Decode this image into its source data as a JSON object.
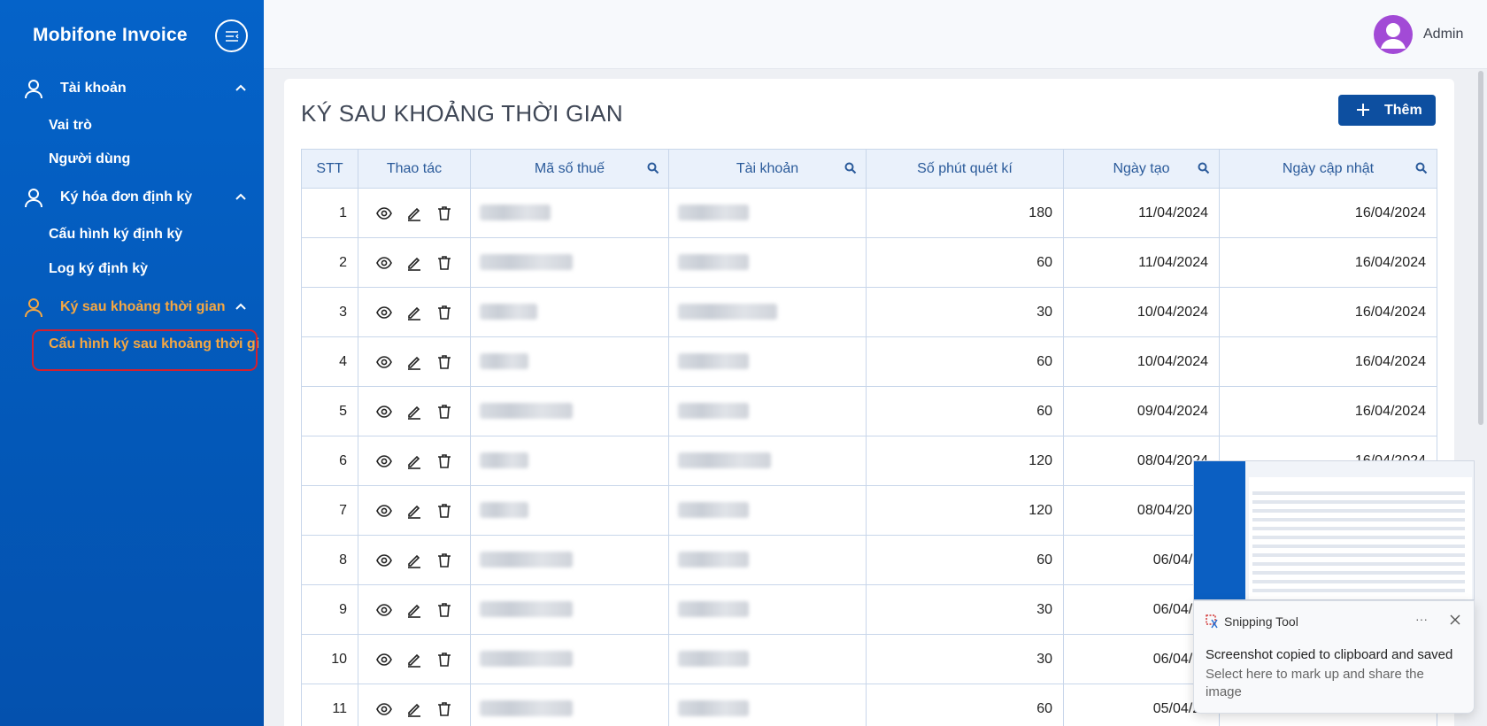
{
  "sidebar": {
    "brand": "Mobifone Invoice",
    "groups": [
      {
        "label": "Tài khoản",
        "items": [
          "Vai trò",
          "Người dùng"
        ]
      },
      {
        "label": "Ký hóa đơn định kỳ",
        "items": [
          "Cấu hình ký định kỳ",
          "Log ký định kỳ"
        ]
      },
      {
        "label": "Ký sau khoảng thời gian",
        "items": [
          "Cấu hình ký sau khoảng thời gi"
        ]
      }
    ],
    "active_color": "#f5a742"
  },
  "header": {
    "user_name": "Admin"
  },
  "page": {
    "title": "KÝ SAU KHOẢNG THỜI GIAN",
    "add_label": "Thêm"
  },
  "table": {
    "columns": [
      "STT",
      "Thao tác",
      "Mã số thuế",
      "Tài khoản",
      "Số phút quét kí",
      "Ngày tạo",
      "Ngày cập nhật"
    ],
    "rows": [
      {
        "stt": "1",
        "minutes": "180",
        "created": "11/04/2024",
        "updated": "16/04/2024"
      },
      {
        "stt": "2",
        "minutes": "60",
        "created": "11/04/2024",
        "updated": "16/04/2024"
      },
      {
        "stt": "3",
        "minutes": "30",
        "created": "10/04/2024",
        "updated": "16/04/2024"
      },
      {
        "stt": "4",
        "minutes": "60",
        "created": "10/04/2024",
        "updated": "16/04/2024"
      },
      {
        "stt": "5",
        "minutes": "60",
        "created": "09/04/2024",
        "updated": "16/04/2024"
      },
      {
        "stt": "6",
        "minutes": "120",
        "created": "08/04/2024",
        "updated": "16/04/2024"
      },
      {
        "stt": "7",
        "minutes": "120",
        "created": "08/04/2024",
        "updated": ""
      },
      {
        "stt": "8",
        "minutes": "60",
        "created": "06/04/20",
        "updated": ""
      },
      {
        "stt": "9",
        "minutes": "30",
        "created": "06/04/20",
        "updated": ""
      },
      {
        "stt": "10",
        "minutes": "30",
        "created": "06/04/20",
        "updated": ""
      },
      {
        "stt": "11",
        "minutes": "60",
        "created": "05/04/20",
        "updated": ""
      }
    ]
  },
  "snipping_tool": {
    "app_name": "Snipping Tool",
    "more": "···",
    "message": "Screenshot copied to clipboard and saved",
    "sub_message": "Select here to mark up and share the image"
  }
}
